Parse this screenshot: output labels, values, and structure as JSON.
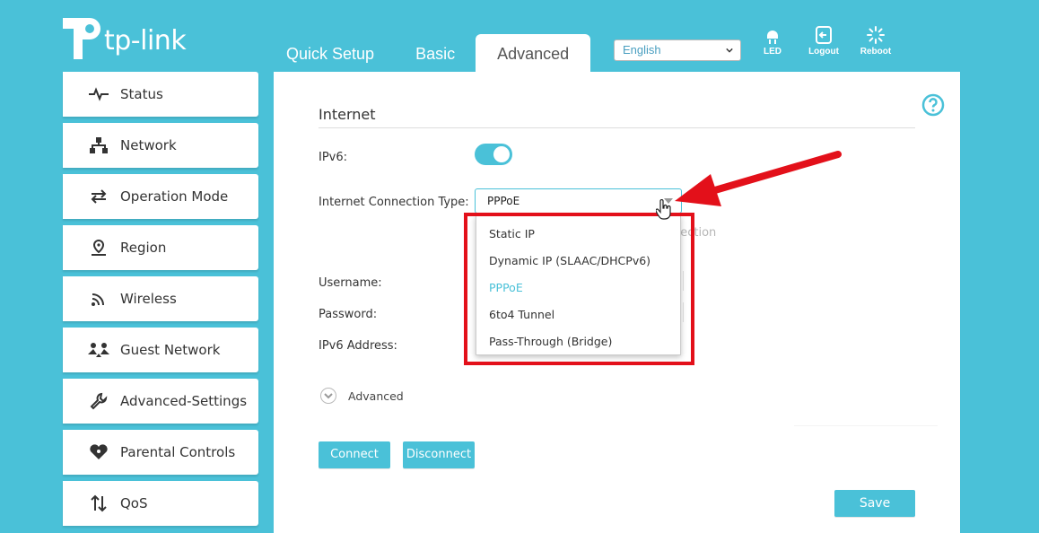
{
  "brand": {
    "name": "tp-link",
    "accent_color": "#4ac1d8",
    "highlight_color": "#e3101a"
  },
  "tabs": [
    {
      "label": "Quick Setup",
      "active": false
    },
    {
      "label": "Basic",
      "active": false
    },
    {
      "label": "Advanced",
      "active": true
    }
  ],
  "language": {
    "selected": "English"
  },
  "top_icons": [
    {
      "label": "LED",
      "icon": "led-bulb-icon"
    },
    {
      "label": "Logout",
      "icon": "logout-icon"
    },
    {
      "label": "Reboot",
      "icon": "reboot-icon"
    }
  ],
  "sidebar": {
    "items": [
      {
        "label": "Status",
        "icon": "pulse-icon"
      },
      {
        "label": "Network",
        "icon": "network-icon"
      },
      {
        "label": "Operation Mode",
        "icon": "swap-arrows-icon"
      },
      {
        "label": "Region",
        "icon": "location-pin-icon"
      },
      {
        "label": "Wireless",
        "icon": "wifi-icon"
      },
      {
        "label": "Guest Network",
        "icon": "guests-icon"
      },
      {
        "label": "Advanced-Settings",
        "icon": "wrench-icon"
      },
      {
        "label": "Parental Controls",
        "icon": "heart-icon"
      },
      {
        "label": "QoS",
        "icon": "up-down-arrows-icon"
      }
    ]
  },
  "main": {
    "section_title": "Internet",
    "ipv6_label": "IPv6:",
    "ipv6_enabled": true,
    "connection_type_label": "Internet Connection Type:",
    "connection_type_value": "PPPoE",
    "hint_text_partial": "nection",
    "username_label": "Username:",
    "password_label": "Password:",
    "ipv6_address_label": "IPv6 Address:",
    "dropdown_options": [
      {
        "label": "Static IP",
        "selected": false
      },
      {
        "label": "Dynamic IP (SLAAC/DHCPv6)",
        "selected": false
      },
      {
        "label": "PPPoE",
        "selected": true
      },
      {
        "label": "6to4 Tunnel",
        "selected": false
      },
      {
        "label": "Pass-Through (Bridge)",
        "selected": false
      }
    ],
    "advanced_toggle_label": "Advanced",
    "connect_label": "Connect",
    "disconnect_label": "Disconnect",
    "save_label": "Save"
  }
}
